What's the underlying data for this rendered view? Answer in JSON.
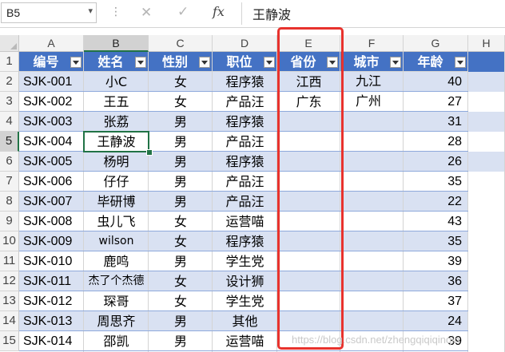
{
  "formula_bar": {
    "name_box": "B5",
    "name_box_arrow_icon": "chevron-down-icon",
    "separator_icon": "vertical-dots-icon",
    "cancel_icon": "close-icon",
    "enter_icon": "check-icon",
    "function_label": "fx",
    "content": "王静波"
  },
  "sheet": {
    "selected_cell": "B5",
    "columns": [
      "A",
      "B",
      "C",
      "D",
      "E",
      "F",
      "G",
      "H"
    ],
    "row_numbers": [
      "1",
      "2",
      "3",
      "4",
      "5",
      "6",
      "7",
      "8",
      "9",
      "10",
      "11",
      "12",
      "13",
      "14",
      "15"
    ],
    "headers": [
      "编号",
      "姓名",
      "性别",
      "职位",
      "省份",
      "城市",
      "年龄"
    ],
    "filter_icon": "filter-dropdown-icon",
    "rows": [
      [
        "SJK-001",
        "小C",
        "女",
        "程序猿",
        "江西",
        "九江",
        "40"
      ],
      [
        "SJK-002",
        "王五",
        "女",
        "产品汪",
        "广东",
        "广州",
        "27"
      ],
      [
        "SJK-003",
        "张荔",
        "男",
        "程序猿",
        "",
        "",
        "31"
      ],
      [
        "SJK-004",
        "王静波",
        "男",
        "产品汪",
        "",
        "",
        "28"
      ],
      [
        "SJK-005",
        "杨明",
        "男",
        "程序猿",
        "",
        "",
        "26"
      ],
      [
        "SJK-006",
        "仔仔",
        "男",
        "产品汪",
        "",
        "",
        "35"
      ],
      [
        "SJK-007",
        "毕研博",
        "男",
        "产品汪",
        "",
        "",
        "22"
      ],
      [
        "SJK-008",
        "虫儿飞",
        "女",
        "运营喵",
        "",
        "",
        "43"
      ],
      [
        "SJK-009",
        "wilson",
        "女",
        "程序猿",
        "",
        "",
        "35"
      ],
      [
        "SJK-010",
        "鹿鸣",
        "男",
        "学生党",
        "",
        "",
        "39"
      ],
      [
        "SJK-011",
        "杰了个杰德",
        "女",
        "设计狮",
        "",
        "",
        "36"
      ],
      [
        "SJK-012",
        "琛哥",
        "女",
        "学生党",
        "",
        "",
        "37"
      ],
      [
        "SJK-013",
        "周思齐",
        "男",
        "其他",
        "",
        "",
        "24"
      ],
      [
        "SJK-014",
        "邵凯",
        "男",
        "运营喵",
        "",
        "",
        "39"
      ]
    ]
  },
  "colors": {
    "header_fill": "#4472c4",
    "band_fill": "#d9e1f2",
    "selection_green": "#217346",
    "highlight_red": "#e8322d"
  },
  "watermark": "https://blog.csdn.net/zhengqiqiqinqin"
}
